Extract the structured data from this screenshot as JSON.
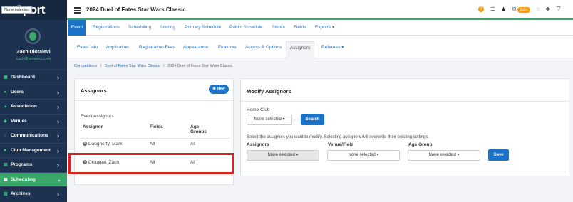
{
  "sidebar": {
    "logo_text": "otSport",
    "club_dropdown": "None selected",
    "user_name": "Zach Diōtalevi",
    "user_email": "zach@gotsport.com",
    "items": [
      {
        "label": "Dashboard",
        "icon": "dashboard-icon"
      },
      {
        "label": "Users",
        "icon": "users-icon"
      },
      {
        "label": "Association",
        "icon": "association-icon"
      },
      {
        "label": "Venues",
        "icon": "venues-icon"
      },
      {
        "label": "Communications",
        "icon": "communications-icon"
      },
      {
        "label": "Club Management",
        "icon": "club-icon"
      },
      {
        "label": "Programs",
        "icon": "programs-icon"
      },
      {
        "label": "Scheduling",
        "icon": "scheduling-icon",
        "active": true
      },
      {
        "label": "Archives",
        "icon": "archives-icon"
      }
    ]
  },
  "topbar": {
    "title": "2024 Duel of Fates Star Wars Classic",
    "mail_badge": "999+"
  },
  "primary_tabs": [
    "Event",
    "Registrations",
    "Scheduling",
    "Scoring",
    "Primary Schedule",
    "Public Schedule",
    "Stores",
    "Fields",
    "Exports ▾"
  ],
  "secondary_tabs": [
    "Event Info",
    "Application",
    "Registration Fees",
    "Appearance",
    "Features",
    "Access & Options",
    "Assignors",
    "Referees ▾"
  ],
  "breadcrumb": {
    "items": [
      "Competitions",
      "Duel of Fates Star Wars Classic"
    ],
    "current": "2024 Duel of Fates Star Wars Classic",
    "sep": "/"
  },
  "assignors_panel": {
    "title": "Assignors",
    "new_button": "New",
    "section_label": "Event Assignors",
    "columns": [
      "Assignor",
      "Fields",
      "Age Groups"
    ],
    "rows": [
      {
        "assignor": "Daugherty, Mark",
        "fields": "All",
        "age_groups": "All"
      },
      {
        "assignor": "Diotalevi, Zach",
        "fields": "All",
        "age_groups": "All"
      }
    ]
  },
  "modify_panel": {
    "title": "Modify Assignors",
    "home_club_label": "Home Club",
    "home_club_value": "None selected ▾",
    "search_button": "Search",
    "instruction": "Select the assignors you want to modify. Selecting assignors will overwrite their existing settings.",
    "assignors_label": "Assignors",
    "assignors_value": "None selected ▾",
    "venue_label": "Venue/Field",
    "venue_value": "None selected ▾",
    "age_label": "Age Group",
    "age_value": "None selected ▾",
    "save_button": "Save"
  }
}
